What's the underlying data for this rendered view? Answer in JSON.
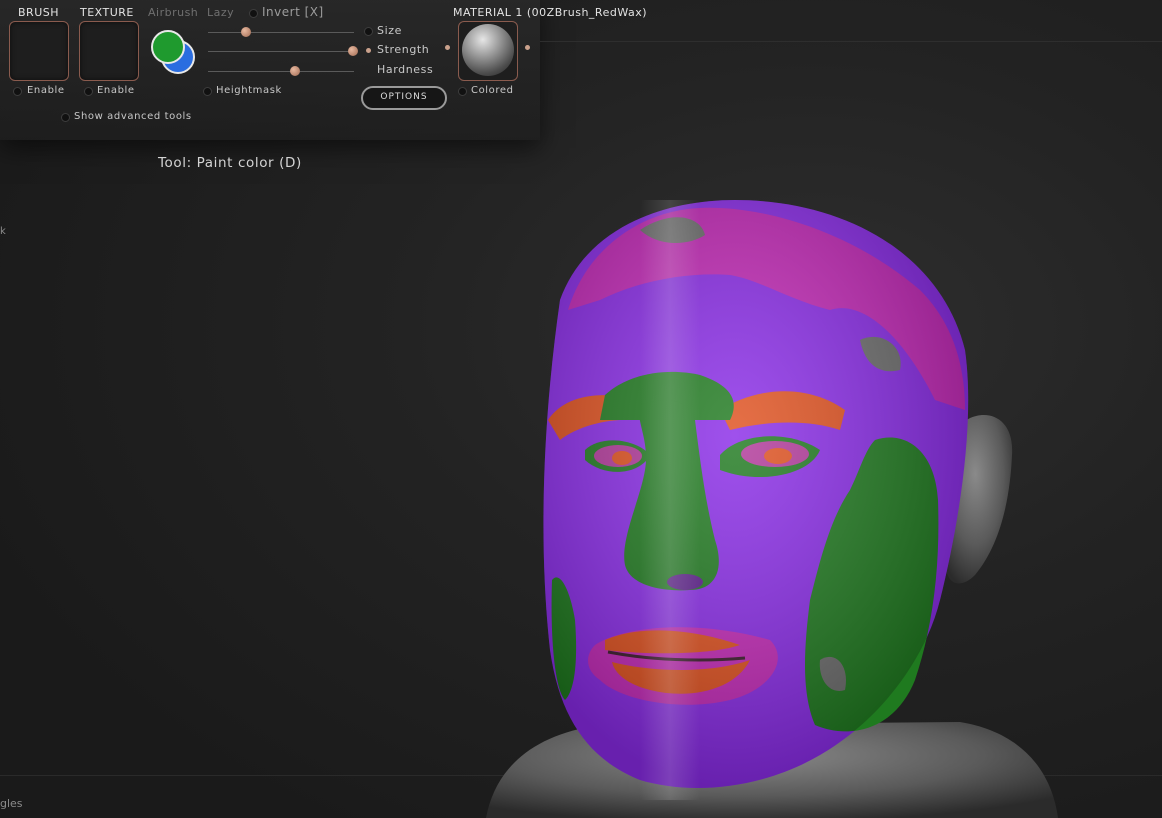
{
  "toolbar": {
    "brush": {
      "header": "BRUSH",
      "enable_label": "Enable"
    },
    "texture": {
      "header": "TEXTURE",
      "enable_label": "Enable"
    },
    "airbrush_label": "Airbrush",
    "lazy_label": "Lazy",
    "invert_label": "Invert [X]",
    "heightmask_label": "Heightmask",
    "show_advanced_label": "Show advanced tools",
    "colors": {
      "primary": "#1f9a2e",
      "secondary": "#2a6de0"
    },
    "sliders": {
      "size_label": "Size",
      "strength_label": "Strength",
      "hardness_label": "Hardness"
    },
    "options_label": "OPTIONS",
    "material": {
      "header": "MATERIAL 1 (00ZBrush_RedWax)",
      "colored_label": "Colored"
    }
  },
  "tool_name": "Tool: Paint color (D)",
  "edge_text": {
    "left_mid": "k",
    "bottom_left": "gles"
  },
  "viewport": {
    "paint_colors": {
      "purple": "#8a2be8",
      "magenta": "#c428b8",
      "green": "#1f7a1f",
      "orange": "#e0501e",
      "clay": "#6d6d6d"
    }
  }
}
